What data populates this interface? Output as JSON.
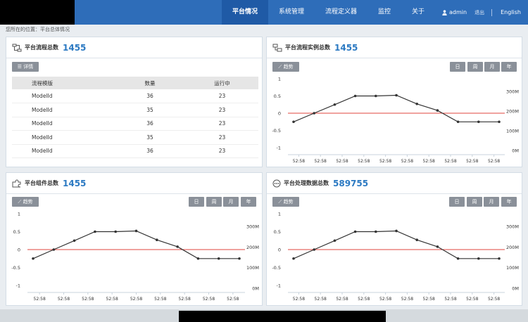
{
  "nav": {
    "items": [
      "平台情况",
      "系统管理",
      "流程定义器",
      "监控",
      "关于"
    ],
    "user": "admin",
    "logout": "退出",
    "lang": "English"
  },
  "breadcrumb": "您所在的位置：平台总体情况",
  "panels": {
    "process_total": {
      "title": "平台流程总数",
      "count": "1455",
      "detail_btn": "详情"
    },
    "instance_total": {
      "title": "平台流程实例总数",
      "count": "1455"
    },
    "component_total": {
      "title": "平台组件总数",
      "count": "1455"
    },
    "data_total": {
      "title": "平台处理数据总数",
      "count": "589755"
    }
  },
  "table": {
    "headers": [
      "流程模版",
      "数量",
      "运行中"
    ],
    "rows": [
      [
        "ModelId",
        "36",
        "23"
      ],
      [
        "ModelId",
        "35",
        "23"
      ],
      [
        "ModelId",
        "36",
        "23"
      ],
      [
        "ModelId",
        "35",
        "23"
      ],
      [
        "ModelId",
        "36",
        "23"
      ]
    ]
  },
  "controls": {
    "trend": "趋势",
    "periods": [
      "日",
      "周",
      "月",
      "年"
    ]
  },
  "chart_data": [
    {
      "type": "line",
      "title": "",
      "x": [
        "52:58",
        "52:58",
        "52:58",
        "52:58",
        "52:58",
        "52:58",
        "52:58",
        "52:58",
        "52:58",
        "52:58"
      ],
      "series": [
        {
          "values": [
            -0.25,
            0,
            0.25,
            0.5,
            0.5,
            0.52,
            0.27,
            0.08,
            -0.25,
            -0.25,
            -0.25
          ]
        }
      ],
      "ylim": [
        -1,
        1
      ],
      "yticks_left": [
        "1",
        "0.5",
        "0",
        "-0.5",
        "-1"
      ],
      "yticks_right": [
        "300M",
        "200M",
        "100M",
        "0M"
      ],
      "reference_line": 0,
      "colors": {
        "line": "#333333",
        "reference": "#e0443e"
      }
    },
    {
      "type": "line",
      "title": "",
      "x": [
        "52:58",
        "52:58",
        "52:58",
        "52:58",
        "52:58",
        "52:58",
        "52:58",
        "52:58",
        "52:58"
      ],
      "series": [
        {
          "values": [
            -0.25,
            0,
            0.25,
            0.5,
            0.5,
            0.52,
            0.27,
            0.08,
            -0.25,
            -0.25,
            -0.25
          ]
        }
      ],
      "ylim": [
        -1,
        1
      ],
      "yticks_left": [
        "1",
        "0.5",
        "0",
        "-0.5",
        "-1"
      ],
      "yticks_right": [
        "300M",
        "200M",
        "100M",
        "0M"
      ],
      "reference_line": 0,
      "colors": {
        "line": "#333333",
        "reference": "#e0443e"
      }
    },
    {
      "type": "line",
      "title": "",
      "x": [
        "52:58",
        "52:58",
        "52:58",
        "52:58",
        "52:58",
        "52:58",
        "52:58",
        "52:58",
        "52:58",
        "52:58"
      ],
      "series": [
        {
          "values": [
            -0.25,
            0,
            0.25,
            0.5,
            0.5,
            0.52,
            0.27,
            0.08,
            -0.25,
            -0.25,
            -0.25
          ]
        }
      ],
      "ylim": [
        -1,
        1
      ],
      "yticks_left": [
        "1",
        "0.5",
        "0",
        "-0.5",
        "-1"
      ],
      "yticks_right": [
        "300M",
        "200M",
        "100M",
        "0M"
      ],
      "reference_line": 0,
      "colors": {
        "line": "#333333",
        "reference": "#e0443e"
      }
    }
  ]
}
